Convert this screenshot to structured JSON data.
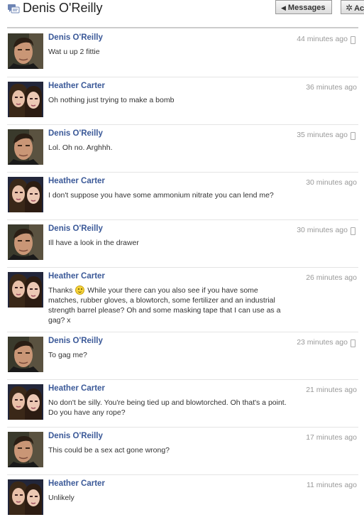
{
  "header": {
    "title": "Denis O'Reilly",
    "messages_button": "Messages",
    "actions_button": "Ac"
  },
  "messages": [
    {
      "sender": "Denis O'Reilly",
      "time": "44 minutes ago",
      "text": "Wat u up 2 fittie",
      "mobile": true,
      "avatar": "denis"
    },
    {
      "sender": "Heather Carter",
      "time": "36 minutes ago",
      "text": "Oh nothing just trying to make a bomb",
      "mobile": false,
      "avatar": "heather"
    },
    {
      "sender": "Denis O'Reilly",
      "time": "35 minutes ago",
      "text": "Lol. Oh no. Arghhh.",
      "mobile": true,
      "avatar": "denis"
    },
    {
      "sender": "Heather Carter",
      "time": "30 minutes ago",
      "text": "I don't suppose you have some ammonium nitrate you can lend me?",
      "mobile": false,
      "avatar": "heather"
    },
    {
      "sender": "Denis O'Reilly",
      "time": "30 minutes ago",
      "text": "Ill have a look in the drawer",
      "mobile": true,
      "avatar": "denis"
    },
    {
      "sender": "Heather Carter",
      "time": "26 minutes ago",
      "text_before_smiley": "Thanks",
      "text": "While your there can you also see if you have some matches, rubber gloves, a blowtorch, some fertilizer and an industrial strength barrel please? Oh and some masking tape that I can use as a gag? x",
      "mobile": false,
      "avatar": "heather"
    },
    {
      "sender": "Denis O'Reilly",
      "time": "23 minutes ago",
      "text": "To gag me?",
      "mobile": true,
      "avatar": "denis"
    },
    {
      "sender": "Heather Carter",
      "time": "21 minutes ago",
      "text": "No don't be silly. You're being tied up and blowtorched. Oh that's a point. Do you have any rope?",
      "mobile": false,
      "avatar": "heather"
    },
    {
      "sender": "Denis O'Reilly",
      "time": "17 minutes ago",
      "text": "This could be a sex act gone wrong?",
      "mobile": false,
      "avatar": "denis"
    },
    {
      "sender": "Heather Carter",
      "time": "11 minutes ago",
      "text": "Unlikely",
      "mobile": false,
      "avatar": "heather"
    }
  ]
}
